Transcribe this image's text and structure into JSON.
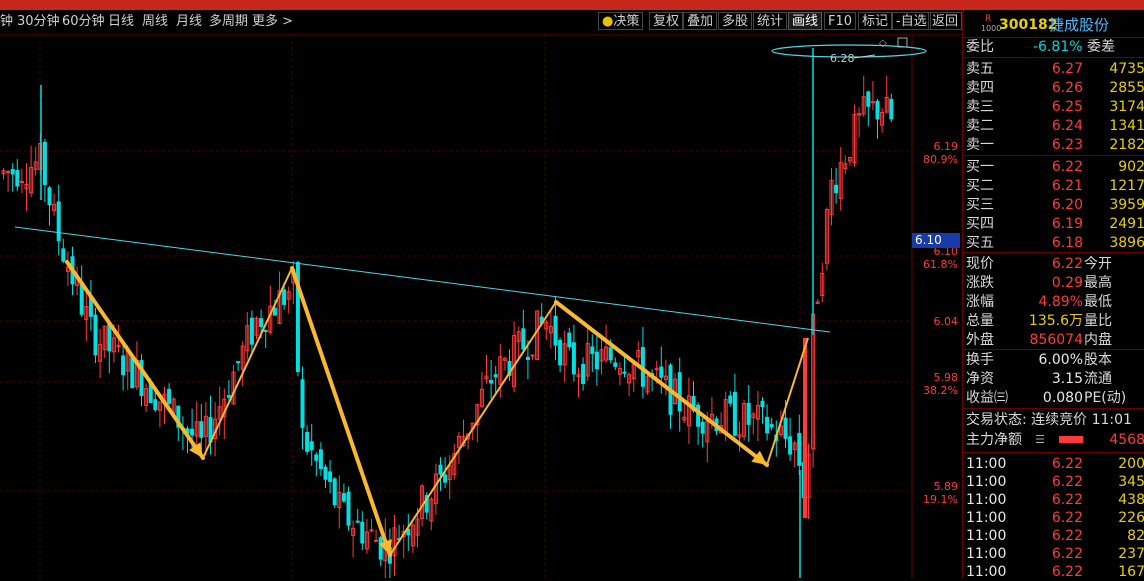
{
  "toolbar": {
    "left_items": [
      "钟",
      "30分钟",
      "60分钟",
      "日线",
      "周线",
      "月线",
      "多周期",
      "更多 >"
    ],
    "right_items": [
      "决策",
      "复权",
      "叠加",
      "多股",
      "统计",
      "画线",
      "F10",
      "标记",
      "-自选",
      "返回"
    ],
    "active_item": "画线"
  },
  "colors": {
    "up": "#ff3a3a",
    "down": "#00e0e0",
    "grid": "#4a0000",
    "annotation": "#f8b830",
    "neckline": "#4ad6e6"
  },
  "chart": {
    "price_labels": [
      {
        "price": "6.19",
        "pct": "80.9%"
      },
      {
        "price": "6.10",
        "pct": "61.8%"
      },
      {
        "price": "6.04",
        "pct": ""
      },
      {
        "price": "5.98",
        "pct": "38.2%"
      },
      {
        "price": "5.89",
        "pct": "19.1%"
      }
    ],
    "current_marker": "6.10",
    "high_label": "6.28"
  },
  "stock": {
    "market_tag": "R",
    "level": "1000",
    "code": "300182",
    "name": "捷成股份"
  },
  "committee": {
    "label1": "委比",
    "value": "-6.81%",
    "label2": "委差"
  },
  "asks": [
    {
      "label": "卖五",
      "price": "6.27",
      "vol": "4735"
    },
    {
      "label": "卖四",
      "price": "6.26",
      "vol": "2855"
    },
    {
      "label": "卖三",
      "price": "6.25",
      "vol": "3174"
    },
    {
      "label": "卖二",
      "price": "6.24",
      "vol": "1341"
    },
    {
      "label": "卖一",
      "price": "6.23",
      "vol": "2182"
    }
  ],
  "bids": [
    {
      "label": "买一",
      "price": "6.22",
      "vol": "902"
    },
    {
      "label": "买二",
      "price": "6.21",
      "vol": "1217"
    },
    {
      "label": "买三",
      "price": "6.20",
      "vol": "3959"
    },
    {
      "label": "买四",
      "price": "6.19",
      "vol": "2491"
    },
    {
      "label": "买五",
      "price": "6.18",
      "vol": "3896"
    }
  ],
  "quote": [
    {
      "l": "现价",
      "v": "6.22",
      "r": "今开"
    },
    {
      "l": "涨跌",
      "v": "0.29",
      "r": "最高"
    },
    {
      "l": "涨幅",
      "v": "4.89%",
      "r": "最低"
    },
    {
      "l": "总量",
      "v": "135.6万",
      "r": "量比"
    },
    {
      "l": "外盘",
      "v": "856074",
      "r": "内盘"
    },
    {
      "l": "换手",
      "v": "6.00%",
      "r": "股本"
    },
    {
      "l": "净资",
      "v": "3.15",
      "r": "流通"
    },
    {
      "l": "收益㈢",
      "v": "0.080",
      "r": "PE(动)"
    }
  ],
  "trade_status": "交易状态: 连续竞价 11:01",
  "main_flow": {
    "label": "主力净额",
    "value": "4568"
  },
  "ticks": [
    {
      "t": "11:00",
      "p": "6.22",
      "v": "200"
    },
    {
      "t": "11:00",
      "p": "6.22",
      "v": "345"
    },
    {
      "t": "11:00",
      "p": "6.22",
      "v": "438"
    },
    {
      "t": "11:00",
      "p": "6.22",
      "v": "226"
    },
    {
      "t": "11:00",
      "p": "6.22",
      "v": "82"
    },
    {
      "t": "11:00",
      "p": "6.22",
      "v": "237"
    },
    {
      "t": "11:00",
      "p": "6.22",
      "v": "167"
    }
  ]
}
